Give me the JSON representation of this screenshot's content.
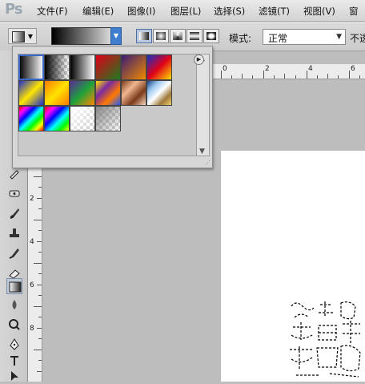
{
  "app": {
    "logo_text": "Ps"
  },
  "menu": {
    "items": [
      {
        "label": "文件(F)"
      },
      {
        "label": "编辑(E)"
      },
      {
        "label": "图像(I)"
      },
      {
        "label": "图层(L)"
      },
      {
        "label": "选择(S)"
      },
      {
        "label": "滤镜(T)"
      },
      {
        "label": "视图(V)"
      },
      {
        "label": "窗"
      }
    ]
  },
  "options_bar": {
    "mode_label": "模式:",
    "mode_value": "正常",
    "opacity_label": "不透",
    "gradient_types": [
      "linear",
      "radial",
      "angle",
      "reflected",
      "diamond"
    ],
    "selected_gradient_type": "linear"
  },
  "gradient_panel": {
    "presets": [
      {
        "name": "Foreground to Background",
        "colors": [
          "#000000",
          "#ffffff"
        ]
      },
      {
        "name": "Foreground to Transparent",
        "colors": [
          "#000000",
          "transparent"
        ]
      },
      {
        "name": "Black, White",
        "colors": [
          "#000000",
          "#ffffff"
        ]
      },
      {
        "name": "Red, Green",
        "colors": [
          "#e0001a",
          "#1e7a1e"
        ]
      },
      {
        "name": "Violet, Orange",
        "colors": [
          "#3a1c72",
          "#f08a00"
        ]
      },
      {
        "name": "Blue, Red, Yellow",
        "colors": [
          "#1432c8",
          "#e0001a",
          "#ffe100"
        ]
      },
      {
        "name": "Blue, Yellow, Blue",
        "colors": [
          "#1e2ecc",
          "#ffe500",
          "#1e2ecc"
        ]
      },
      {
        "name": "Orange, Yellow, Orange",
        "colors": [
          "#ff7a00",
          "#ffe300",
          "#ff7a00"
        ]
      },
      {
        "name": "Violet, Green, Orange",
        "colors": [
          "#5a2a9a",
          "#1ea23a",
          "#ff8800"
        ]
      },
      {
        "name": "Yellow, Violet, Orange, Blue",
        "colors": [
          "#ffe300",
          "#7a2aa0",
          "#ff7a00",
          "#1e5aff"
        ]
      },
      {
        "name": "Copper",
        "colors": [
          "#7a3a1a",
          "#f0b890",
          "#7a3a1a",
          "#f8d8c0"
        ]
      },
      {
        "name": "Chrome",
        "colors": [
          "#1a3a7a",
          "#9ac8f0",
          "#ffffff",
          "#a0783a",
          "#f0d070"
        ]
      },
      {
        "name": "Spectrum",
        "colors": [
          "#ff0000",
          "#ff00ff",
          "#0000ff",
          "#00ffff",
          "#00ff00",
          "#ffff00",
          "#ff0000"
        ]
      },
      {
        "name": "Transparent Rainbow",
        "colors": [
          "#ff0000",
          "#ff00ff",
          "#0000ff",
          "#00ffff",
          "#00ff00",
          "#ffff00"
        ]
      },
      {
        "name": "Transparent Stripes",
        "colors": [
          "#ffffff",
          "transparent"
        ]
      },
      {
        "name": "Neutral Density",
        "colors": [
          "#888888",
          "transparent"
        ]
      }
    ],
    "selected_index": 0
  },
  "rulers": {
    "vertical_labels": [
      "2",
      "4",
      "6",
      "8"
    ],
    "horizontal_labels": [
      "0",
      "2",
      "4",
      "6"
    ]
  },
  "tools": [
    {
      "name": "ruler-tool"
    },
    {
      "name": "spot-healing-tool"
    },
    {
      "name": "brush-tool"
    },
    {
      "name": "clone-stamp-tool"
    },
    {
      "name": "history-brush-tool"
    },
    {
      "name": "eraser-tool"
    },
    {
      "name": "gradient-tool"
    },
    {
      "name": "blur-tool"
    },
    {
      "name": "dodge-tool"
    },
    {
      "name": "pen-tool"
    },
    {
      "name": "type-tool"
    },
    {
      "name": "path-selection-tool"
    }
  ],
  "colors": {
    "accent": "#3b68c4",
    "canvas_bg": "#ffffff",
    "workspace_bg": "#bdbdbd"
  }
}
